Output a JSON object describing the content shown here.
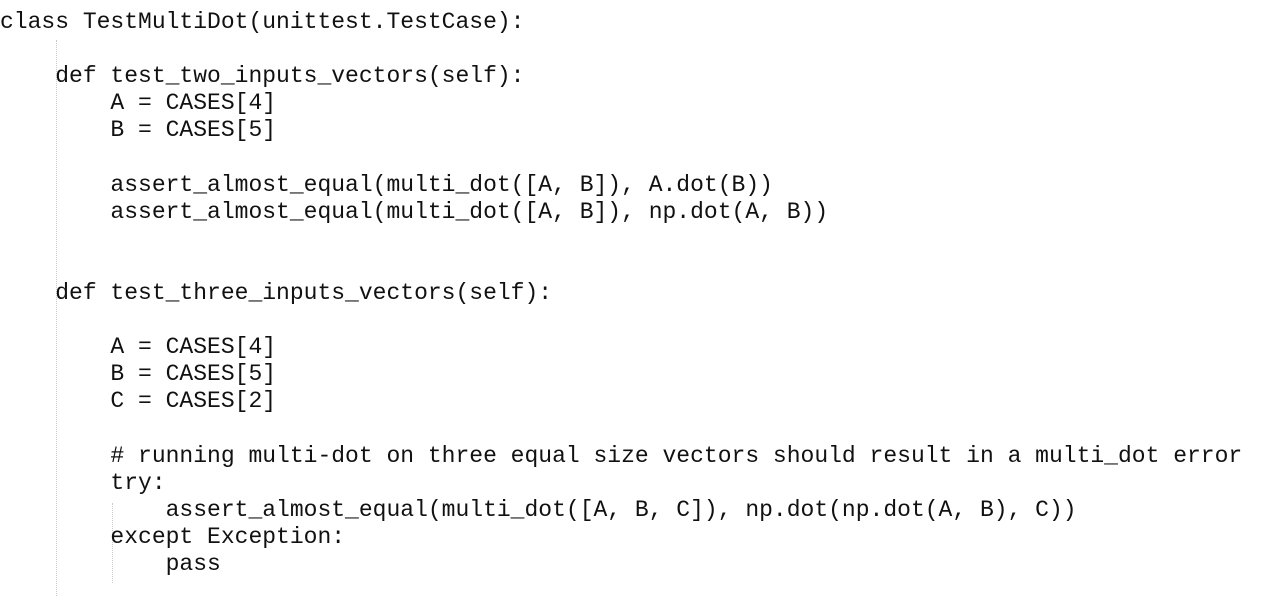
{
  "editor": {
    "lines": [
      "class TestMultiDot(unittest.TestCase):",
      "",
      "    def test_two_inputs_vectors(self):",
      "        A = CASES[4]",
      "        B = CASES[5]",
      "",
      "        assert_almost_equal(multi_dot([A, B]), A.dot(B))",
      "        assert_almost_equal(multi_dot([A, B]), np.dot(A, B))",
      "",
      "",
      "    def test_three_inputs_vectors(self):",
      "",
      "        A = CASES[4]",
      "        B = CASES[5]",
      "        C = CASES[2]",
      "",
      "        # running multi-dot on three equal size vectors should result in a multi_dot error",
      "        try:",
      "            assert_almost_equal(multi_dot([A, B, C]), np.dot(np.dot(A, B), C))",
      "        except Exception:",
      "            pass"
    ]
  }
}
